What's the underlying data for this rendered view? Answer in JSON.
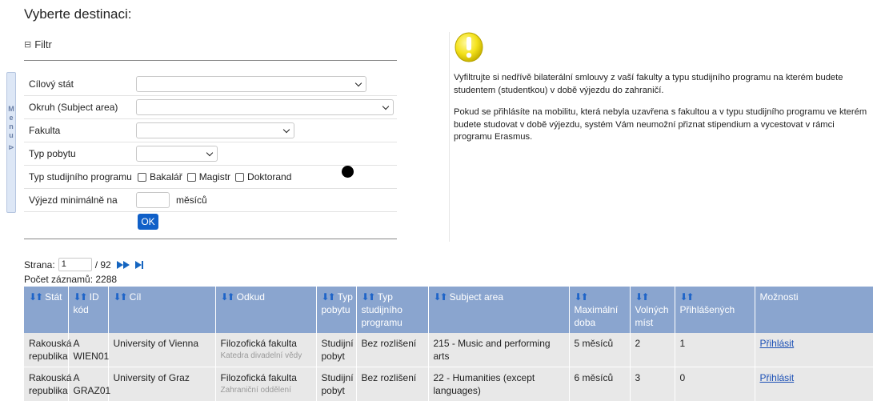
{
  "page_title": "Vyberte destinaci:",
  "filter": {
    "toggle_label": "Filtr",
    "menu_letters": [
      "M",
      "e",
      "n",
      "u"
    ],
    "rows": [
      {
        "label": "Cílový stát"
      },
      {
        "label": "Okruh (Subject area)"
      },
      {
        "label": "Fakulta"
      },
      {
        "label": "Typ pobytu"
      },
      {
        "label": "Typ studijního programu"
      },
      {
        "label": "Výjezd minimálně na"
      }
    ],
    "checkboxes": [
      "Bakalář",
      "Magistr",
      "Doktorand"
    ],
    "months_label": "měsíců",
    "ok_label": "OK"
  },
  "info": {
    "paragraph1": "Vyfiltrujte si nedřívě bilaterální smlouvy z vaší fakulty a typu studijního programu na kterém budete studentem (studentkou) v době výjezdu do zahraničí.",
    "paragraph2": "Pokud se přihlásíte na mobilitu, která nebyla uzavřena s fakultou a v typu studijního programu ve kterém budete studovat v době výjezdu, systém Vám neumožní přiznat stipendium a vycestovat v rámci programu Erasmus."
  },
  "pager": {
    "label": "Strana:",
    "current_page": "1",
    "total": "/ 92",
    "count_label": "Počet záznamů: 2288"
  },
  "table": {
    "headers": [
      "Stát",
      "ID kód",
      "Cíl",
      "Odkud",
      "Typ pobytu",
      "Typ studijního programu",
      "Subject area",
      "Maximální doba",
      "Volných míst",
      "Přihlášených",
      "Možnosti"
    ],
    "rows": [
      {
        "stat": "Rakouská republika",
        "id": "A WIEN01",
        "cil": "University of Vienna",
        "odkud": "Filozofická fakulta",
        "odkud_sub": "Katedra divadelní vědy",
        "typ_pobytu": "Studijní pobyt",
        "typ_programu": "Bez rozlišení",
        "subject": "215 - Music and performing arts",
        "doba": "5 měsíců",
        "volnych": "2",
        "prihlasenych": "1",
        "action": "Přihlásit"
      },
      {
        "stat": "Rakouská republika",
        "id": "A GRAZ01",
        "cil": "University of Graz",
        "odkud": "Filozofická fakulta",
        "odkud_sub": "Zahraniční oddělení",
        "typ_pobytu": "Studijní pobyt",
        "typ_programu": "Bez rozlišení",
        "subject": "22 - Humanities (except languages)",
        "doba": "6 měsíců",
        "volnych": "3",
        "prihlasenych": "0",
        "action": "Přihlásit"
      }
    ]
  },
  "colors": {
    "header_bg": "#8aa5cf",
    "accent": "#1060c8",
    "row_bg": "#e8e8e8",
    "warning": "#f7e41a"
  },
  "icons": {
    "warning": "warning-exclamation-icon",
    "sort": "sort-arrows-icon",
    "next": "next-page-icon",
    "last": "last-page-icon"
  }
}
